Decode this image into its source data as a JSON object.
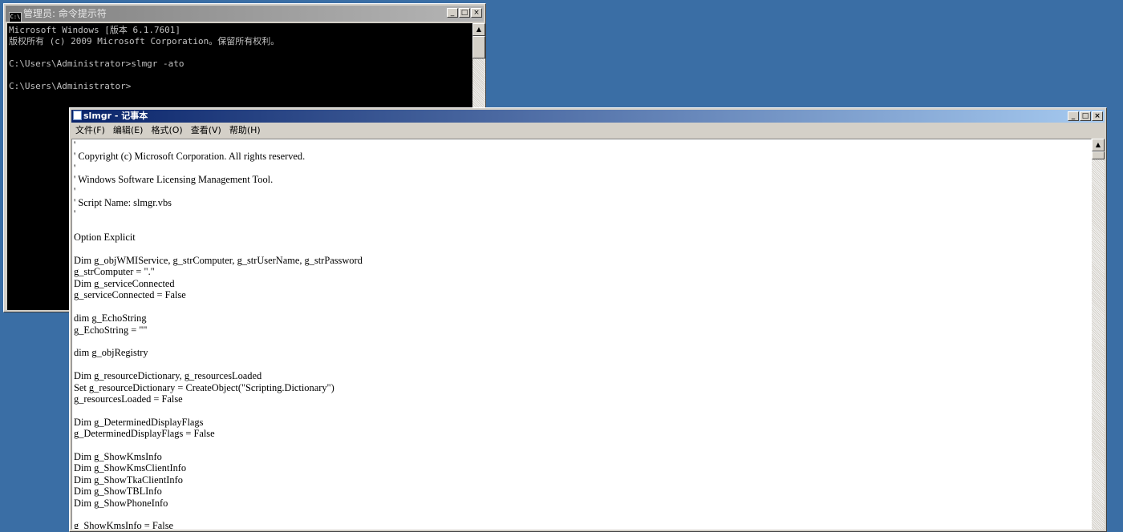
{
  "cmd_window": {
    "title": "管理员: 命令提示符",
    "icon_text": "C:\\",
    "buttons": [
      "_",
      "□",
      "×"
    ],
    "lines": [
      "Microsoft Windows [版本 6.1.7601]",
      "版权所有 (c) 2009 Microsoft Corporation。保留所有权利。",
      "",
      "C:\\Users\\Administrator>slmgr -ato",
      "",
      "C:\\Users\\Administrator>"
    ]
  },
  "notepad_window": {
    "title": "slmgr - 记事本",
    "buttons": [
      "_",
      "□",
      "×"
    ],
    "menu": [
      "文件(F)",
      "编辑(E)",
      "格式(O)",
      "查看(V)",
      "帮助(H)"
    ],
    "content_lines": [
      "'",
      "' Copyright (c) Microsoft Corporation. All rights reserved.",
      "'",
      "' Windows Software Licensing Management Tool.",
      "'",
      "' Script Name: slmgr.vbs",
      "'",
      "",
      "Option Explicit",
      "",
      "Dim g_objWMIService, g_strComputer, g_strUserName, g_strPassword",
      "g_strComputer = \".\"",
      "Dim g_serviceConnected",
      "g_serviceConnected = False",
      "",
      "dim g_EchoString",
      "g_EchoString = \"\"",
      "",
      "dim g_objRegistry",
      "",
      "Dim g_resourceDictionary, g_resourcesLoaded",
      "Set g_resourceDictionary = CreateObject(\"Scripting.Dictionary\")",
      "g_resourcesLoaded = False",
      "",
      "Dim g_DeterminedDisplayFlags",
      "g_DeterminedDisplayFlags = False",
      "",
      "Dim g_ShowKmsInfo",
      "Dim g_ShowKmsClientInfo",
      "Dim g_ShowTkaClientInfo",
      "Dim g_ShowTBLInfo",
      "Dim g_ShowPhoneInfo",
      "",
      "g_ShowKmsInfo = False"
    ]
  }
}
